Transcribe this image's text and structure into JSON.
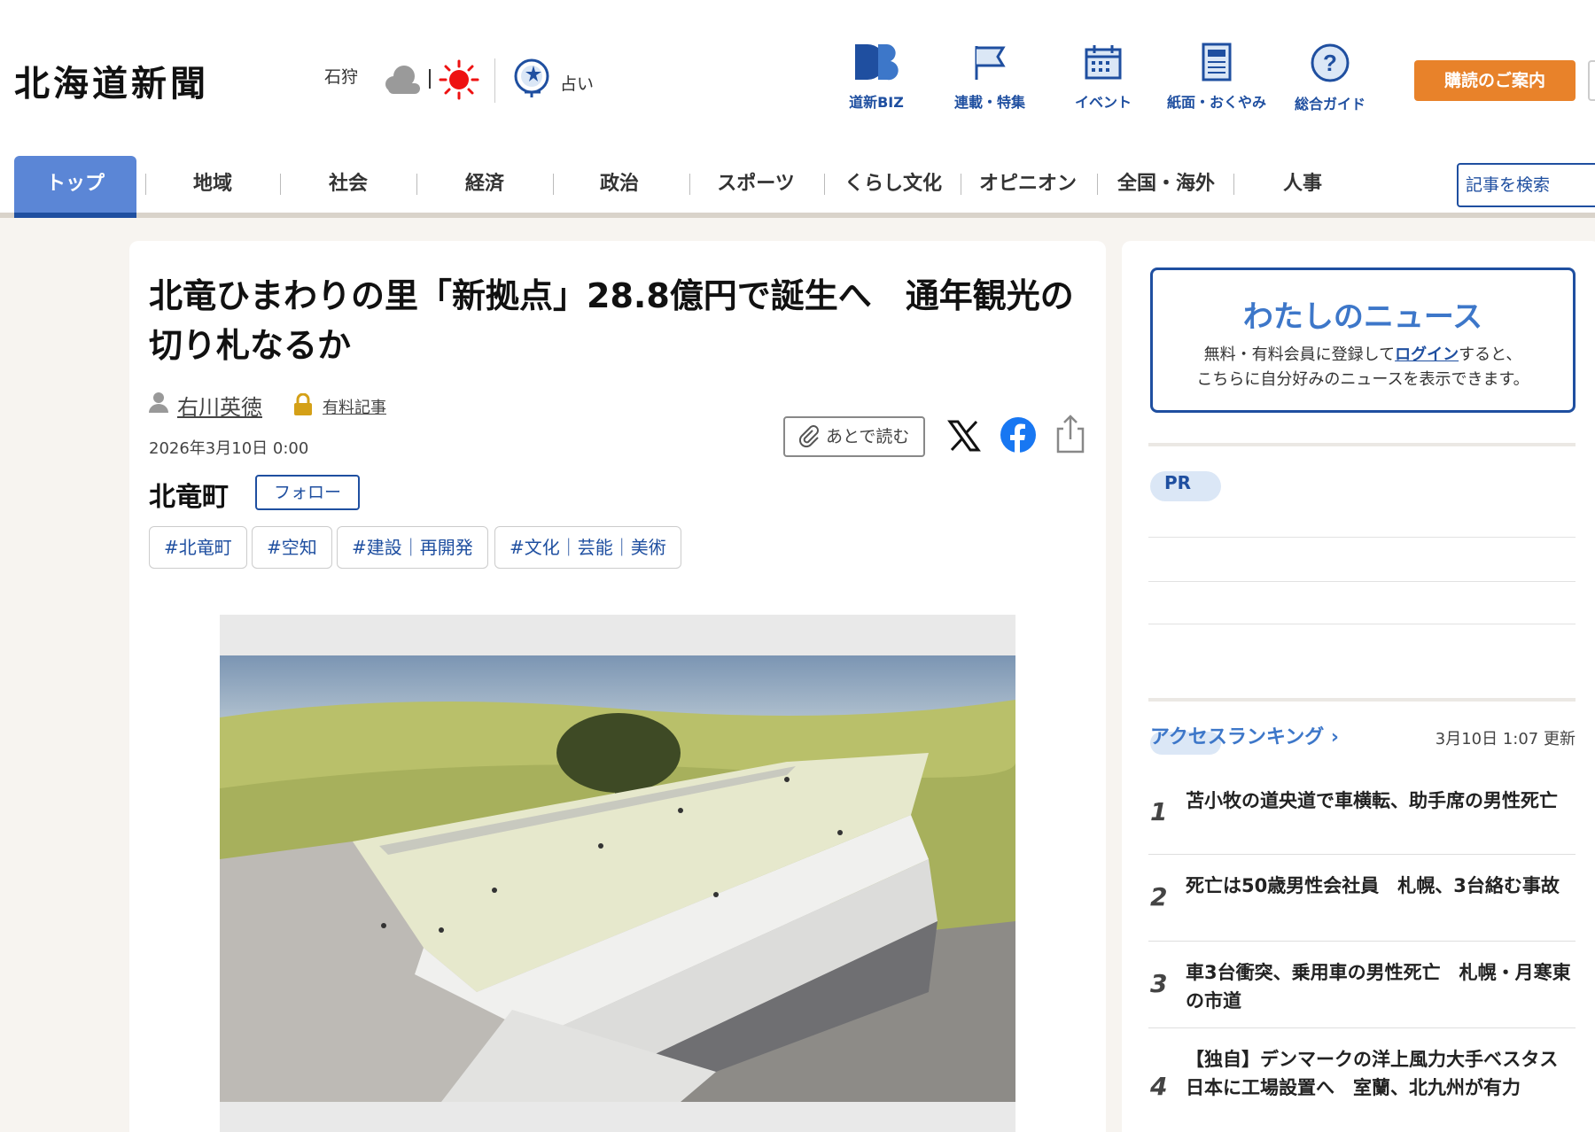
{
  "header": {
    "logo": "北海道新聞",
    "region": "石狩",
    "fortune_label": "占い",
    "nav": [
      {
        "label": "道新BIZ",
        "icon": "db-logo-icon"
      },
      {
        "label": "連載・特集",
        "icon": "flag-icon"
      },
      {
        "label": "イベント",
        "icon": "calendar-icon"
      },
      {
        "label": "紙面・おくやみ",
        "icon": "newspaper-icon"
      },
      {
        "label": "総合ガイド",
        "icon": "help-icon"
      }
    ],
    "subscribe_label": "購読のご案内"
  },
  "categories": [
    "トップ",
    "地域",
    "社会",
    "経済",
    "政治",
    "スポーツ",
    "くらし文化",
    "オピニオン",
    "全国・海外",
    "人事"
  ],
  "search": {
    "placeholder": "記事を検索"
  },
  "article": {
    "headline": "北竜ひまわりの里「新拠点」28.8億円で誕生へ　通年観光の切り札なるか",
    "author": "右川英徳",
    "paid_label": "有料記事",
    "date": "2026年3月10日 0:00",
    "region": "北竜町",
    "follow_label": "フォロー",
    "read_later_label": "あとで読む",
    "tags": [
      "#北竜町",
      "#空知",
      "#建設｜再開発",
      "#文化｜芸能｜美術"
    ]
  },
  "sidebar": {
    "mynews": {
      "title": "わたしのニュース",
      "desc_before": "無料・有料会員に登録して",
      "desc_link": "ログイン",
      "desc_after": "すると、",
      "desc_line2": "こちらに自分好みのニュースを表示できます。"
    },
    "pr_label": "PR",
    "ranking": {
      "title": "アクセスランキング",
      "updated": "3月10日 1:07 更新",
      "items": [
        {
          "rank": "1",
          "title": "苫小牧の道央道で車横転、助手席の男性死亡"
        },
        {
          "rank": "2",
          "title": "死亡は50歳男性会社員　札幌、3台絡む事故"
        },
        {
          "rank": "3",
          "title": "車3台衝突、乗用車の男性死亡　札幌・月寒東の市道"
        },
        {
          "rank": "4",
          "title": "【独自】デンマークの洋上風力大手ベスタス　日本に工場設置へ　室蘭、北九州が有力"
        }
      ]
    }
  },
  "colors": {
    "brand_blue": "#1f4fa0",
    "accent_orange": "#e8822a",
    "active_tab": "#5b86d6"
  }
}
